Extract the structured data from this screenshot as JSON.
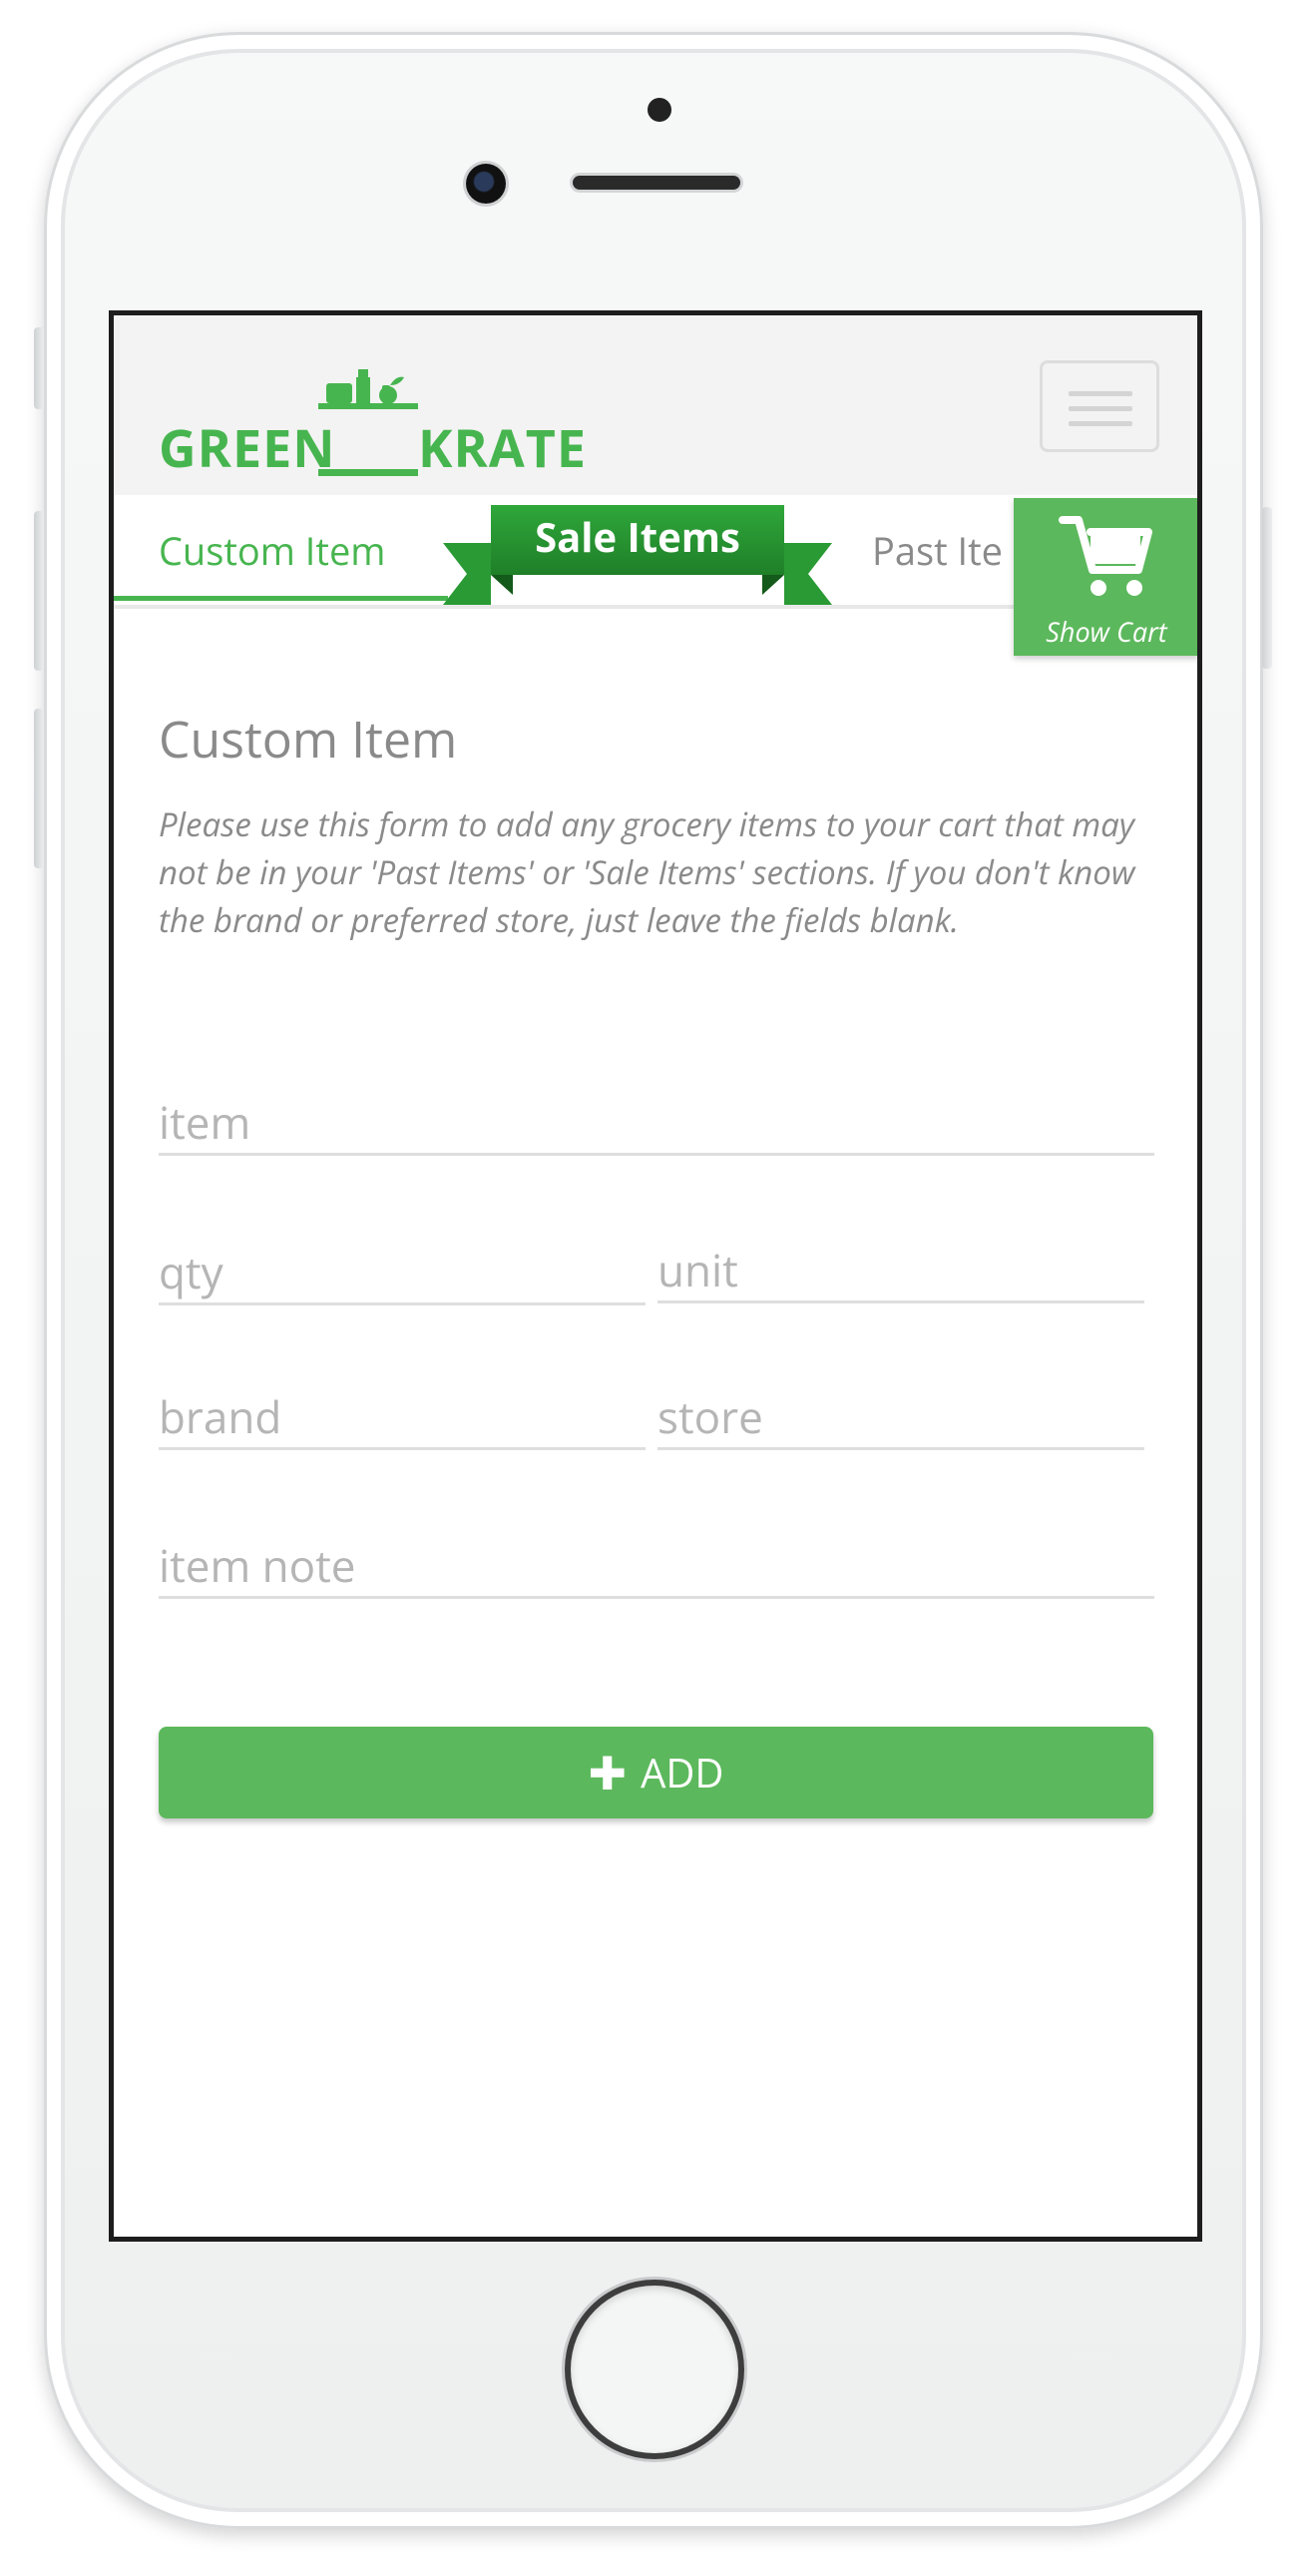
{
  "brand": {
    "left": "GREEN",
    "right": "KRATE",
    "color": "#47b54f"
  },
  "tabs": [
    {
      "label": "Custom Item",
      "active": true
    },
    {
      "label": "Sale Items",
      "style": "ribbon"
    },
    {
      "label": "Past Items",
      "visible_text": "Past Ite"
    }
  ],
  "cart": {
    "label": "Show Cart",
    "icon": "cart-icon",
    "color": "#5cb85c"
  },
  "form": {
    "title": "Custom Item",
    "description": "Please use this form to add any grocery items to your cart that may not be in your 'Past Items' or 'Sale Items' sections. If you don't know the brand or preferred store, just leave the fields blank.",
    "fields": {
      "item": {
        "placeholder": "item",
        "value": ""
      },
      "qty": {
        "placeholder": "qty",
        "value": ""
      },
      "unit": {
        "placeholder": "unit",
        "value": ""
      },
      "brand": {
        "placeholder": "brand",
        "value": ""
      },
      "store": {
        "placeholder": "store",
        "value": ""
      },
      "note": {
        "placeholder": "item note",
        "value": ""
      }
    },
    "submit": {
      "label": "ADD",
      "icon": "plus-icon"
    }
  }
}
